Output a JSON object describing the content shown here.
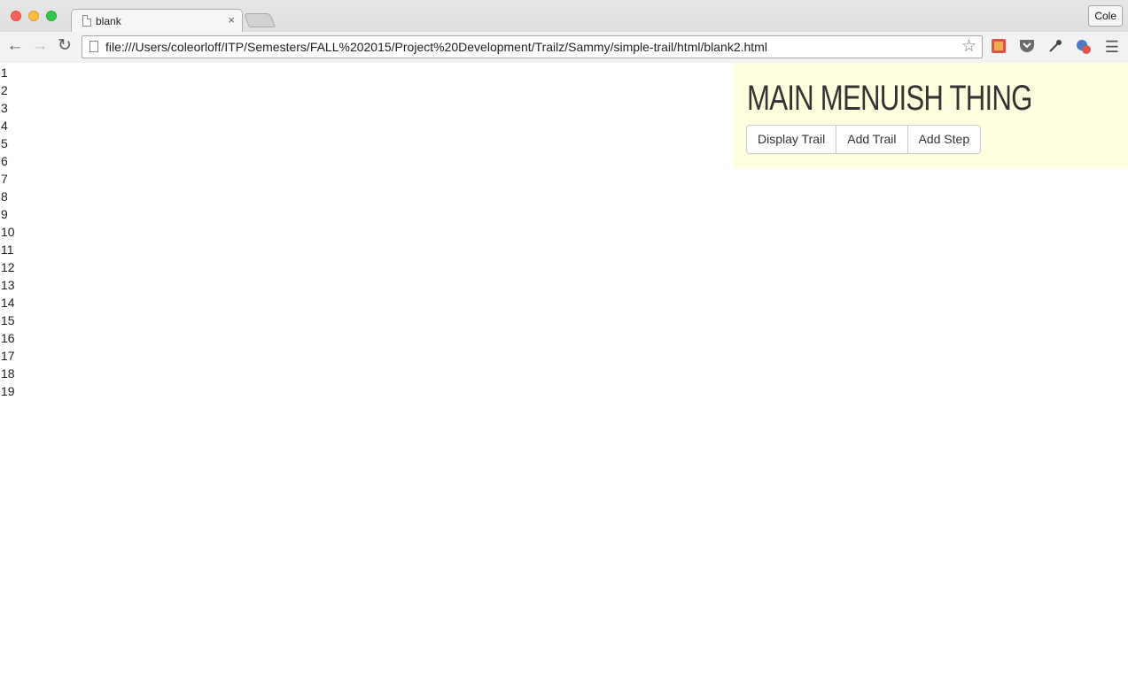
{
  "browser": {
    "tab_title": "blank",
    "tab_close": "×",
    "profile_name": "Cole",
    "url": "file:///Users/coleorloff/ITP/Semesters/FALL%202015/Project%20Development/Trailz/Sammy/simple-trail/html/blank2.html",
    "icons": {
      "back": "back-arrow-icon",
      "forward": "forward-arrow-icon",
      "reload": "reload-icon",
      "star": "bookmark-star-icon",
      "menu": "hamburger-menu-icon"
    },
    "traffic_colors": {
      "close": "#fc605c",
      "minimize": "#fdbc40",
      "maximize": "#34c84a"
    }
  },
  "page": {
    "line_numbers": [
      "1",
      "2",
      "3",
      "4",
      "5",
      "6",
      "7",
      "8",
      "9",
      "10",
      "11",
      "12",
      "13",
      "14",
      "15",
      "16",
      "17",
      "18",
      "19"
    ],
    "menu": {
      "title": "MAIN MENUISH THING",
      "background": "#ffffdf",
      "buttons": [
        "Display Trail",
        "Add Trail",
        "Add Step"
      ]
    }
  }
}
